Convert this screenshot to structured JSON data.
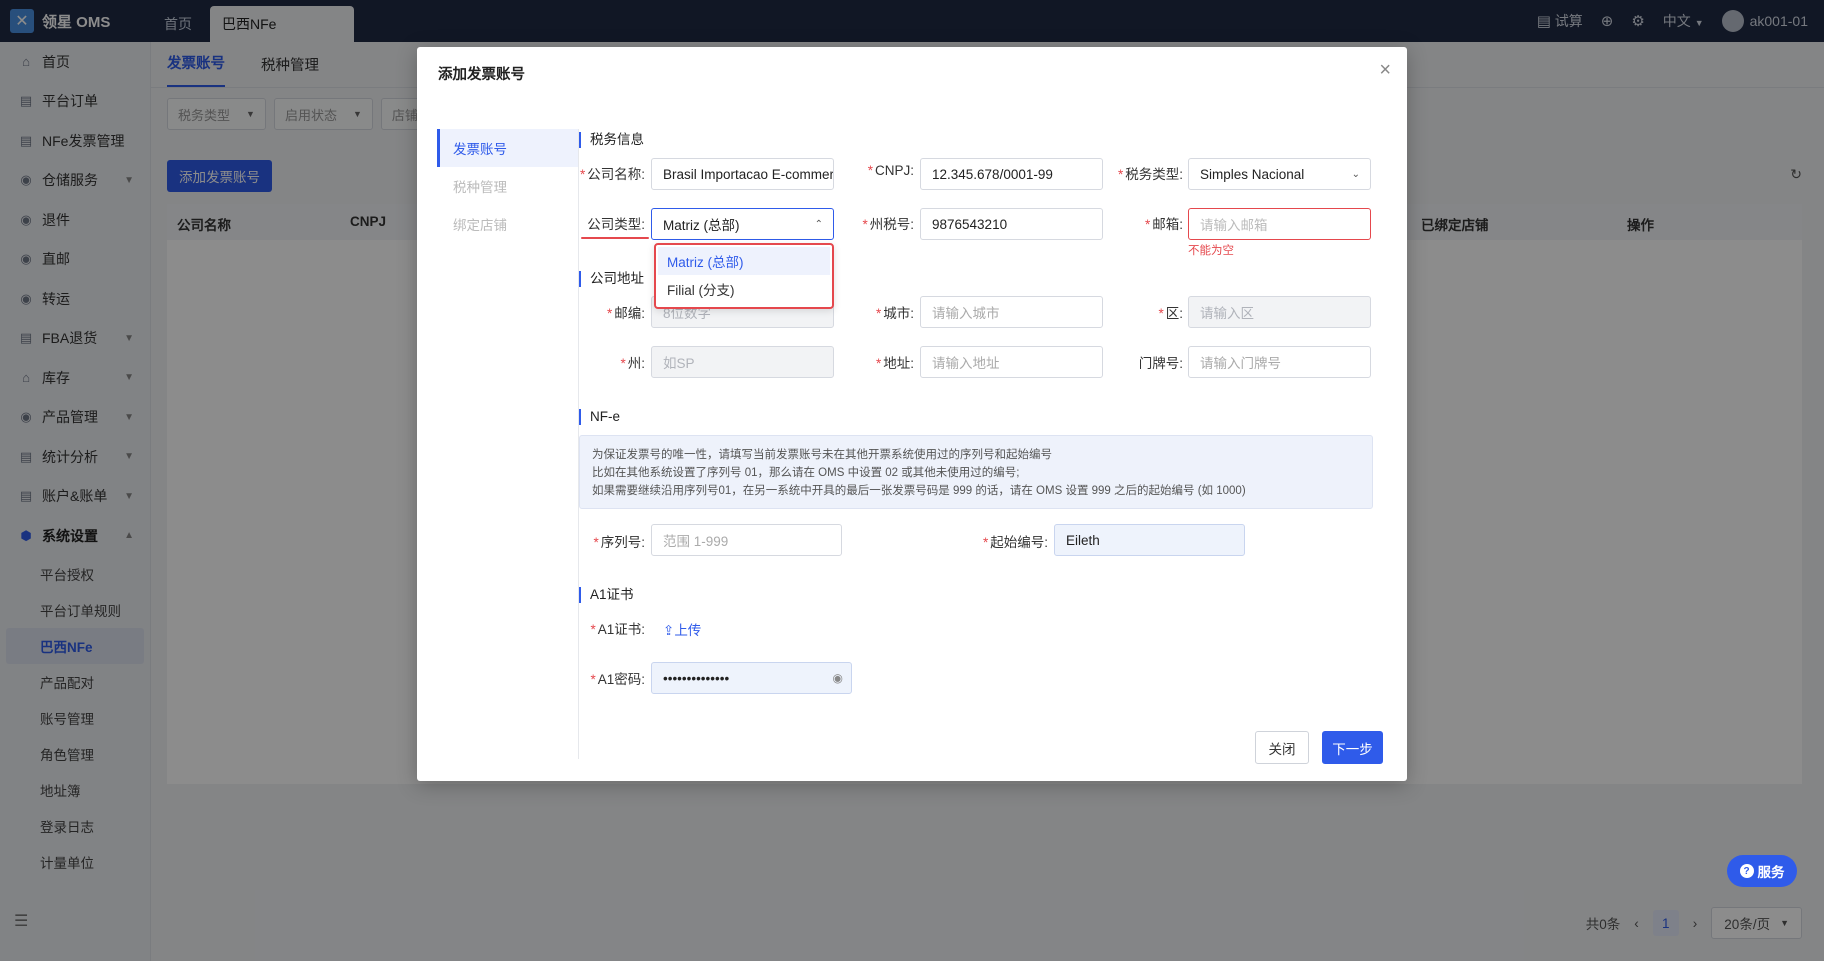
{
  "app": {
    "logo_text": "领星 OMS"
  },
  "top_tabs": [
    {
      "label": "首页"
    },
    {
      "label": "巴西NFe"
    }
  ],
  "top_right": {
    "trial": "试算",
    "lang": "中文",
    "user": "ak001-01"
  },
  "sidebar": {
    "items": [
      {
        "label": "首页",
        "icon": "home-icon"
      },
      {
        "label": "平台订单",
        "icon": "doc-icon"
      },
      {
        "label": "NFe发票管理",
        "icon": "doc-icon"
      },
      {
        "label": "仓储服务",
        "icon": "warehouse-icon"
      },
      {
        "label": "退件",
        "icon": "return-icon"
      },
      {
        "label": "直邮",
        "icon": "mail-icon"
      },
      {
        "label": "转运",
        "icon": "transfer-icon"
      },
      {
        "label": "FBA退货",
        "icon": "fba-icon"
      },
      {
        "label": "库存",
        "icon": "stock-icon"
      },
      {
        "label": "产品管理",
        "icon": "product-icon"
      },
      {
        "label": "统计分析",
        "icon": "stats-icon"
      },
      {
        "label": "账户&账单",
        "icon": "account-icon"
      },
      {
        "label": "系统设置",
        "icon": "settings-icon"
      }
    ],
    "sub_items": [
      {
        "label": "平台授权"
      },
      {
        "label": "平台订单规则"
      },
      {
        "label": "巴西NFe"
      },
      {
        "label": "产品配对"
      },
      {
        "label": "账号管理"
      },
      {
        "label": "角色管理"
      },
      {
        "label": "地址簿"
      },
      {
        "label": "登录日志"
      },
      {
        "label": "计量单位"
      }
    ]
  },
  "page": {
    "subtabs": [
      {
        "label": "发票账号"
      },
      {
        "label": "税种管理"
      }
    ],
    "filters": [
      {
        "label": "税务类型"
      },
      {
        "label": "启用状态"
      },
      {
        "label": "店铺"
      }
    ],
    "add_button": "添加发票账号",
    "table_headers": {
      "company": "公司名称",
      "cnpj": "CNPJ",
      "bound_store": "已绑定店铺",
      "ops": "操作"
    },
    "pager": {
      "total": "共0条",
      "page": "1",
      "page_size": "20条/页"
    }
  },
  "modal": {
    "title": "添加发票账号",
    "nav": [
      {
        "label": "发票账号"
      },
      {
        "label": "税种管理"
      },
      {
        "label": "绑定店铺"
      }
    ],
    "tax_section": "税务信息",
    "company_name_label": "公司名称:",
    "company_name_value": "Brasil Importacao E-commerce",
    "cnpj_label": "CNPJ:",
    "cnpj_value": "12.345.678/0001-99",
    "tax_type_label": "税务类型:",
    "tax_type_value": "Simples Nacional",
    "company_type_label": "公司类型:",
    "company_type_value": "Matriz (总部)",
    "state_tax_label": "州税号:",
    "state_tax_value": "9876543210",
    "email_label": "邮箱:",
    "email_placeholder": "请输入邮箱",
    "email_error": "不能为空",
    "company_type_options": [
      {
        "label": "Matriz (总部)"
      },
      {
        "label": "Filial (分支)"
      }
    ],
    "address_section": "公司地址",
    "zip_label": "邮编:",
    "zip_placeholder": "8位数字",
    "city_label": "城市:",
    "city_placeholder": "请输入城市",
    "district_label": "区:",
    "district_placeholder": "请输入区",
    "state_label": "州:",
    "state_placeholder": "如SP",
    "address_label": "地址:",
    "address_placeholder": "请输入地址",
    "door_label": "门牌号:",
    "door_placeholder": "请输入门牌号",
    "nfe_section": "NF-e",
    "notice_lines": [
      "为保证发票号的唯一性，请填写当前发票账号未在其他开票系统使用过的序列号和起始编号",
      "比如在其他系统设置了序列号 01，那么请在 OMS 中设置 02 或其他未使用过的编号;",
      "如果需要继续沿用序列号01，在另一系统中开具的最后一张发票号码是 999 的话，请在 OMS 设置 999 之后的起始编号 (如 1000)"
    ],
    "serial_label": "序列号:",
    "serial_placeholder": "范围 1-999",
    "start_no_label": "起始编号:",
    "start_no_value": "Eileth",
    "a1_section": "A1证书",
    "a1_cert_label": "A1证书:",
    "upload_label": "上传",
    "a1_pwd_label": "A1密码:",
    "a1_pwd_value": "••••••••••••••",
    "close_button": "关闭",
    "next_button": "下一步"
  },
  "service_button": "服务"
}
